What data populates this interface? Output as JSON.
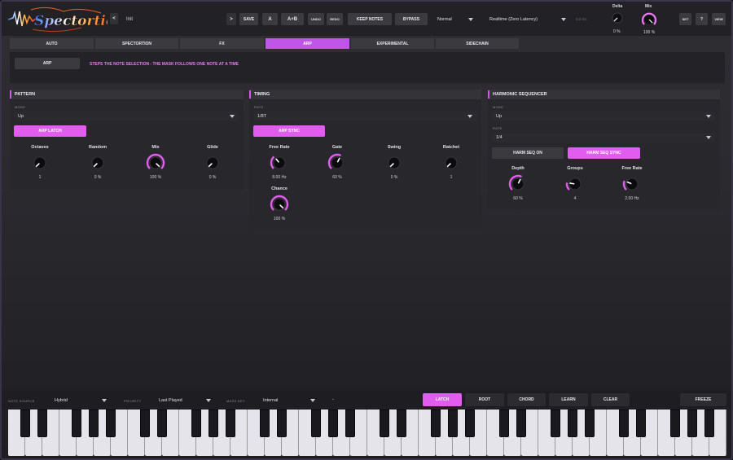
{
  "app": {
    "name": "Spectortion"
  },
  "toolbar": {
    "prev_label": "<",
    "preset_name": "Init",
    "next_label": ">",
    "save_label": "SAVE",
    "a_label": "A",
    "ab_label": "A+B",
    "undo_label": "UNDO",
    "redo_label": "REDO",
    "keep_notes_label": "KEEP NOTES",
    "bypass_label": "BYPASS",
    "mode_value": "Normal",
    "latency_value": "Realtime (Zero Latency)",
    "latency_readout": "0.0 ms",
    "delta_label": "Delta",
    "delta_value": "0 %",
    "mix_label": "Mix",
    "mix_value": "100 %",
    "set_label": "SET",
    "help_label": "?",
    "view_label": "VIEW"
  },
  "tabs": [
    {
      "label": "AUTO"
    },
    {
      "label": "SPECTORTION"
    },
    {
      "label": "FX"
    },
    {
      "label": "ARP"
    },
    {
      "label": "EXPERIMENTAL"
    },
    {
      "label": "SIDECHAIN"
    }
  ],
  "active_tab": "ARP",
  "header": {
    "mode_button": "ARP",
    "description": "STEPS THE NOTE SELECTION - THE MASK FOLLOWS ONE NOTE AT A TIME"
  },
  "pattern": {
    "title": "PATTERN",
    "mode_label": "MODE",
    "mode_value": "Up",
    "latch_button": "ARP LATCH",
    "knobs": [
      {
        "label": "Octaves",
        "value": "1",
        "level": 0.0
      },
      {
        "label": "Random",
        "value": "0 %",
        "level": 0.0
      },
      {
        "label": "Mix",
        "value": "100 %",
        "level": 1.0
      },
      {
        "label": "Glide",
        "value": "0 %",
        "level": 0.0
      }
    ]
  },
  "timing": {
    "title": "TIMING",
    "rate_label": "RATE",
    "rate_value": "1/8T",
    "sync_button": "ARP SYNC",
    "knobs": [
      {
        "label": "Free Rate",
        "value": "8.00 Hz",
        "level": 0.35
      },
      {
        "label": "Gate",
        "value": "60 %",
        "level": 0.6
      },
      {
        "label": "Swing",
        "value": "0 %",
        "level": 0.0
      },
      {
        "label": "Ratchet",
        "value": "1",
        "level": 0.0
      }
    ],
    "chance": {
      "label": "Chance",
      "value": "100 %",
      "level": 1.0
    }
  },
  "harmonic": {
    "title": "HARMONIC SEQUENCER",
    "mode_label": "MODE",
    "mode_value": "Up",
    "rate_label": "RATE",
    "rate_value": "1/4",
    "on_button": "HARM SEQ ON",
    "sync_button": "HARM SEQ SYNC",
    "knobs": [
      {
        "label": "Depth",
        "value": "60 %",
        "level": 0.6
      },
      {
        "label": "Groups",
        "value": "4",
        "level": 0.2
      },
      {
        "label": "Free Rate",
        "value": "2.00 Hz",
        "level": 0.25
      }
    ]
  },
  "bottom": {
    "note_source_label": "NOTE SOURCE",
    "note_source_value": "Hybrid",
    "priority_label": "PRIORITY",
    "priority_value": "Last Played",
    "mask_key_label": "MASK KEY",
    "mask_key_value": "Internal",
    "dash": "-",
    "latch": "LATCH",
    "root": "ROOT",
    "chord": "CHORD",
    "learn": "LEARN",
    "clear": "CLEAR",
    "freeze": "FREEZE"
  },
  "colors": {
    "accent": "#e25cf0",
    "tab_active": "#c056e8"
  }
}
